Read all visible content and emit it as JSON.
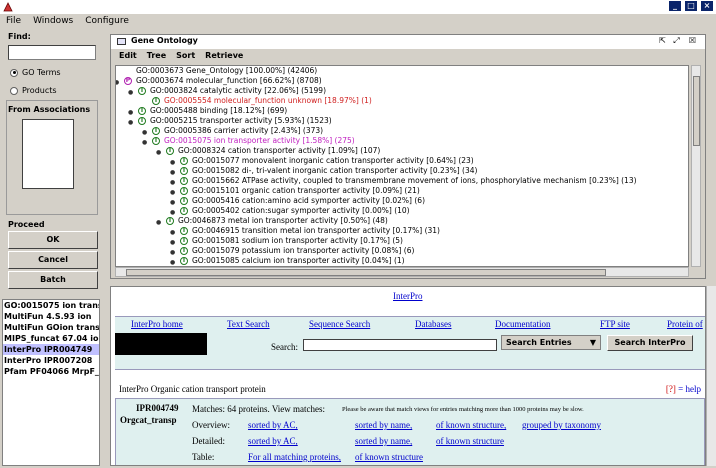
{
  "menubar": {
    "items": [
      "File",
      "Windows",
      "Configure"
    ]
  },
  "left": {
    "find_label": "Find:",
    "find_value": "",
    "radio_go": "GO Terms",
    "radio_products": "Products",
    "from_assoc_label": "From Associations",
    "proceed_label": "Proceed",
    "ok": "OK",
    "cancel": "Cancel",
    "batch": "Batch"
  },
  "history": [
    "GO:0015075 ion transpo",
    "MultiFun 4.S.93 ion",
    "MultiFun GOion transpo",
    "MIPS_funcat 67.04 ion tr",
    "InterPro IPR004749",
    "InterPro IPR007208",
    "Pfam PF04066 MrpF_Ph"
  ],
  "go_panel": {
    "title": "Gene Ontology",
    "menu": [
      "Edit",
      "Tree",
      "Sort",
      "Retrieve"
    ],
    "nodes": [
      "GO:0003673 Gene_Ontology [100.00%] (42406)",
      "GO:0003674 molecular_function [66.62%] (8708)",
      "GO:0003824 catalytic activity [22.06%] (5199)",
      "GO:0005554 molecular_function unknown [18.97%] (1)",
      "GO:0005488 binding [18.12%] (699)",
      "GO:0005215 transporter activity [5.93%] (1523)",
      "GO:0005386 carrier activity [2.43%] (373)",
      "GO:0015075 ion transporter activity [1.58%] (275)",
      "GO:0008324 cation transporter activity [1.09%] (107)",
      "GO:0015077 monovalent inorganic cation transporter activity [0.64%] (23)",
      "GO:0015082 di-, tri-valent inorganic cation transporter activity [0.23%] (34)",
      "GO:0015662 ATPase activity, coupled to transmembrane movement of ions, phosphorylative mechanism [0.23%] (13)",
      "GO:0015101 organic cation transporter activity [0.09%] (21)",
      "GO:0005416 cation:amino acid symporter activity [0.02%] (6)",
      "GO:0005402 cation:sugar symporter activity [0.00%] (10)",
      "GO:0046873 metal ion transporter activity [0.50%] (48)",
      "GO:0046915 transition metal ion transporter activity [0.17%] (31)",
      "GO:0015081 sodium ion transporter activity [0.17%] (5)",
      "GO:0015079 potassium ion transporter activity [0.08%] (6)",
      "GO:0015085 calcium ion transporter activity [0.04%] (1)"
    ],
    "badge_i": "I",
    "badge_p": "P"
  },
  "web": {
    "interpro_link": "InterPro",
    "nav": [
      "InterPro home",
      "Text Search",
      "Sequence Search",
      "Databases",
      "Documentation",
      "FTP site",
      "Protein of"
    ],
    "search_label": "Search:",
    "search_select": "Search Entries",
    "search_button": "Search InterPro",
    "entry_head": "InterPro   Organic cation transport protein",
    "help_q": "[?]",
    "help": " = help",
    "entry_id": "IPR004749",
    "entry_short": "Orgcat_transp",
    "matches": "Matches: 64 proteins. View matches:",
    "warning": "Please be aware that match views for entries matching more than 1000 proteins may be slow.",
    "overview_label": "Overview:",
    "detailed_label": "Detailed:",
    "table_label": "Table:",
    "sorted_ac": "sorted by AC,",
    "sorted_name": "sorted by name,",
    "known_struct": "of known structure,",
    "grouped_tax": "grouped by taxonomy",
    "sorted_ac2": "sorted by AC,",
    "sorted_name2": "sorted by name,",
    "known_struct2": "of known structure",
    "all_matching": "For all matching proteins,",
    "known_struct3": "of known structure"
  }
}
